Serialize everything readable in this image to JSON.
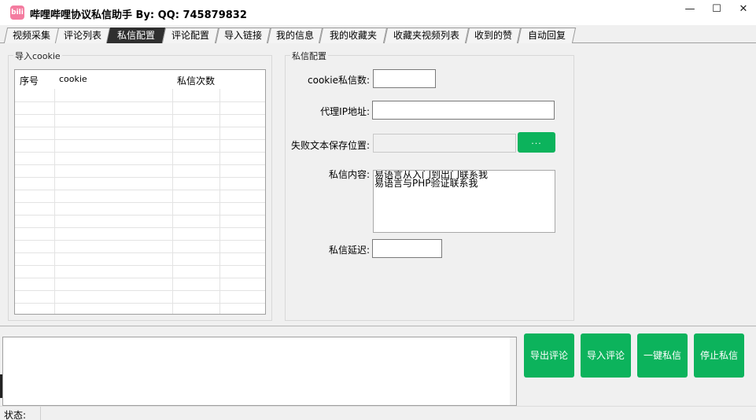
{
  "window": {
    "title": "哔哩哔哩协议私信助手 By:  QQ:  745879832",
    "icon_name": "bilibili-icon",
    "controls": {
      "minimize": "—",
      "maximize": "☐",
      "close": "✕"
    }
  },
  "tabs": [
    {
      "label": "视频采集"
    },
    {
      "label": "评论列表"
    },
    {
      "label": "私信配置",
      "active": true
    },
    {
      "label": "评论配置"
    },
    {
      "label": "导入链接"
    },
    {
      "label": "我的信息"
    },
    {
      "label": "我的收藏夹"
    },
    {
      "label": "收藏夹视频列表"
    },
    {
      "label": "收到的赞"
    },
    {
      "label": "自动回复"
    }
  ],
  "cookie_group": {
    "title": "导入cookie",
    "columns": [
      "序号",
      "cookie",
      "私信次数"
    ],
    "rows": []
  },
  "dm_config": {
    "title": "私信配置",
    "cookie_count_label": "cookie私信数:",
    "cookie_count_value": "",
    "proxy_label": "代理IP地址:",
    "proxy_value": "",
    "fail_path_label": "失败文本保存位置:",
    "fail_path_value": "",
    "browse_label": "...",
    "content_label": "私信内容:",
    "content_value": "易语言从入门到出门联系我\n易语言与PHP验证联系我",
    "delay_label": "私信延迟:",
    "delay_value": ""
  },
  "log": {
    "text": ""
  },
  "actions": {
    "export_comments": "导出评论",
    "import_comments": "导入评论",
    "send_all": "一键私信",
    "stop": "停止私信"
  },
  "status": {
    "label": "状态:",
    "text": ""
  },
  "colors": {
    "accent_green": "#0cb35c",
    "active_tab": "#2f2f2f"
  }
}
